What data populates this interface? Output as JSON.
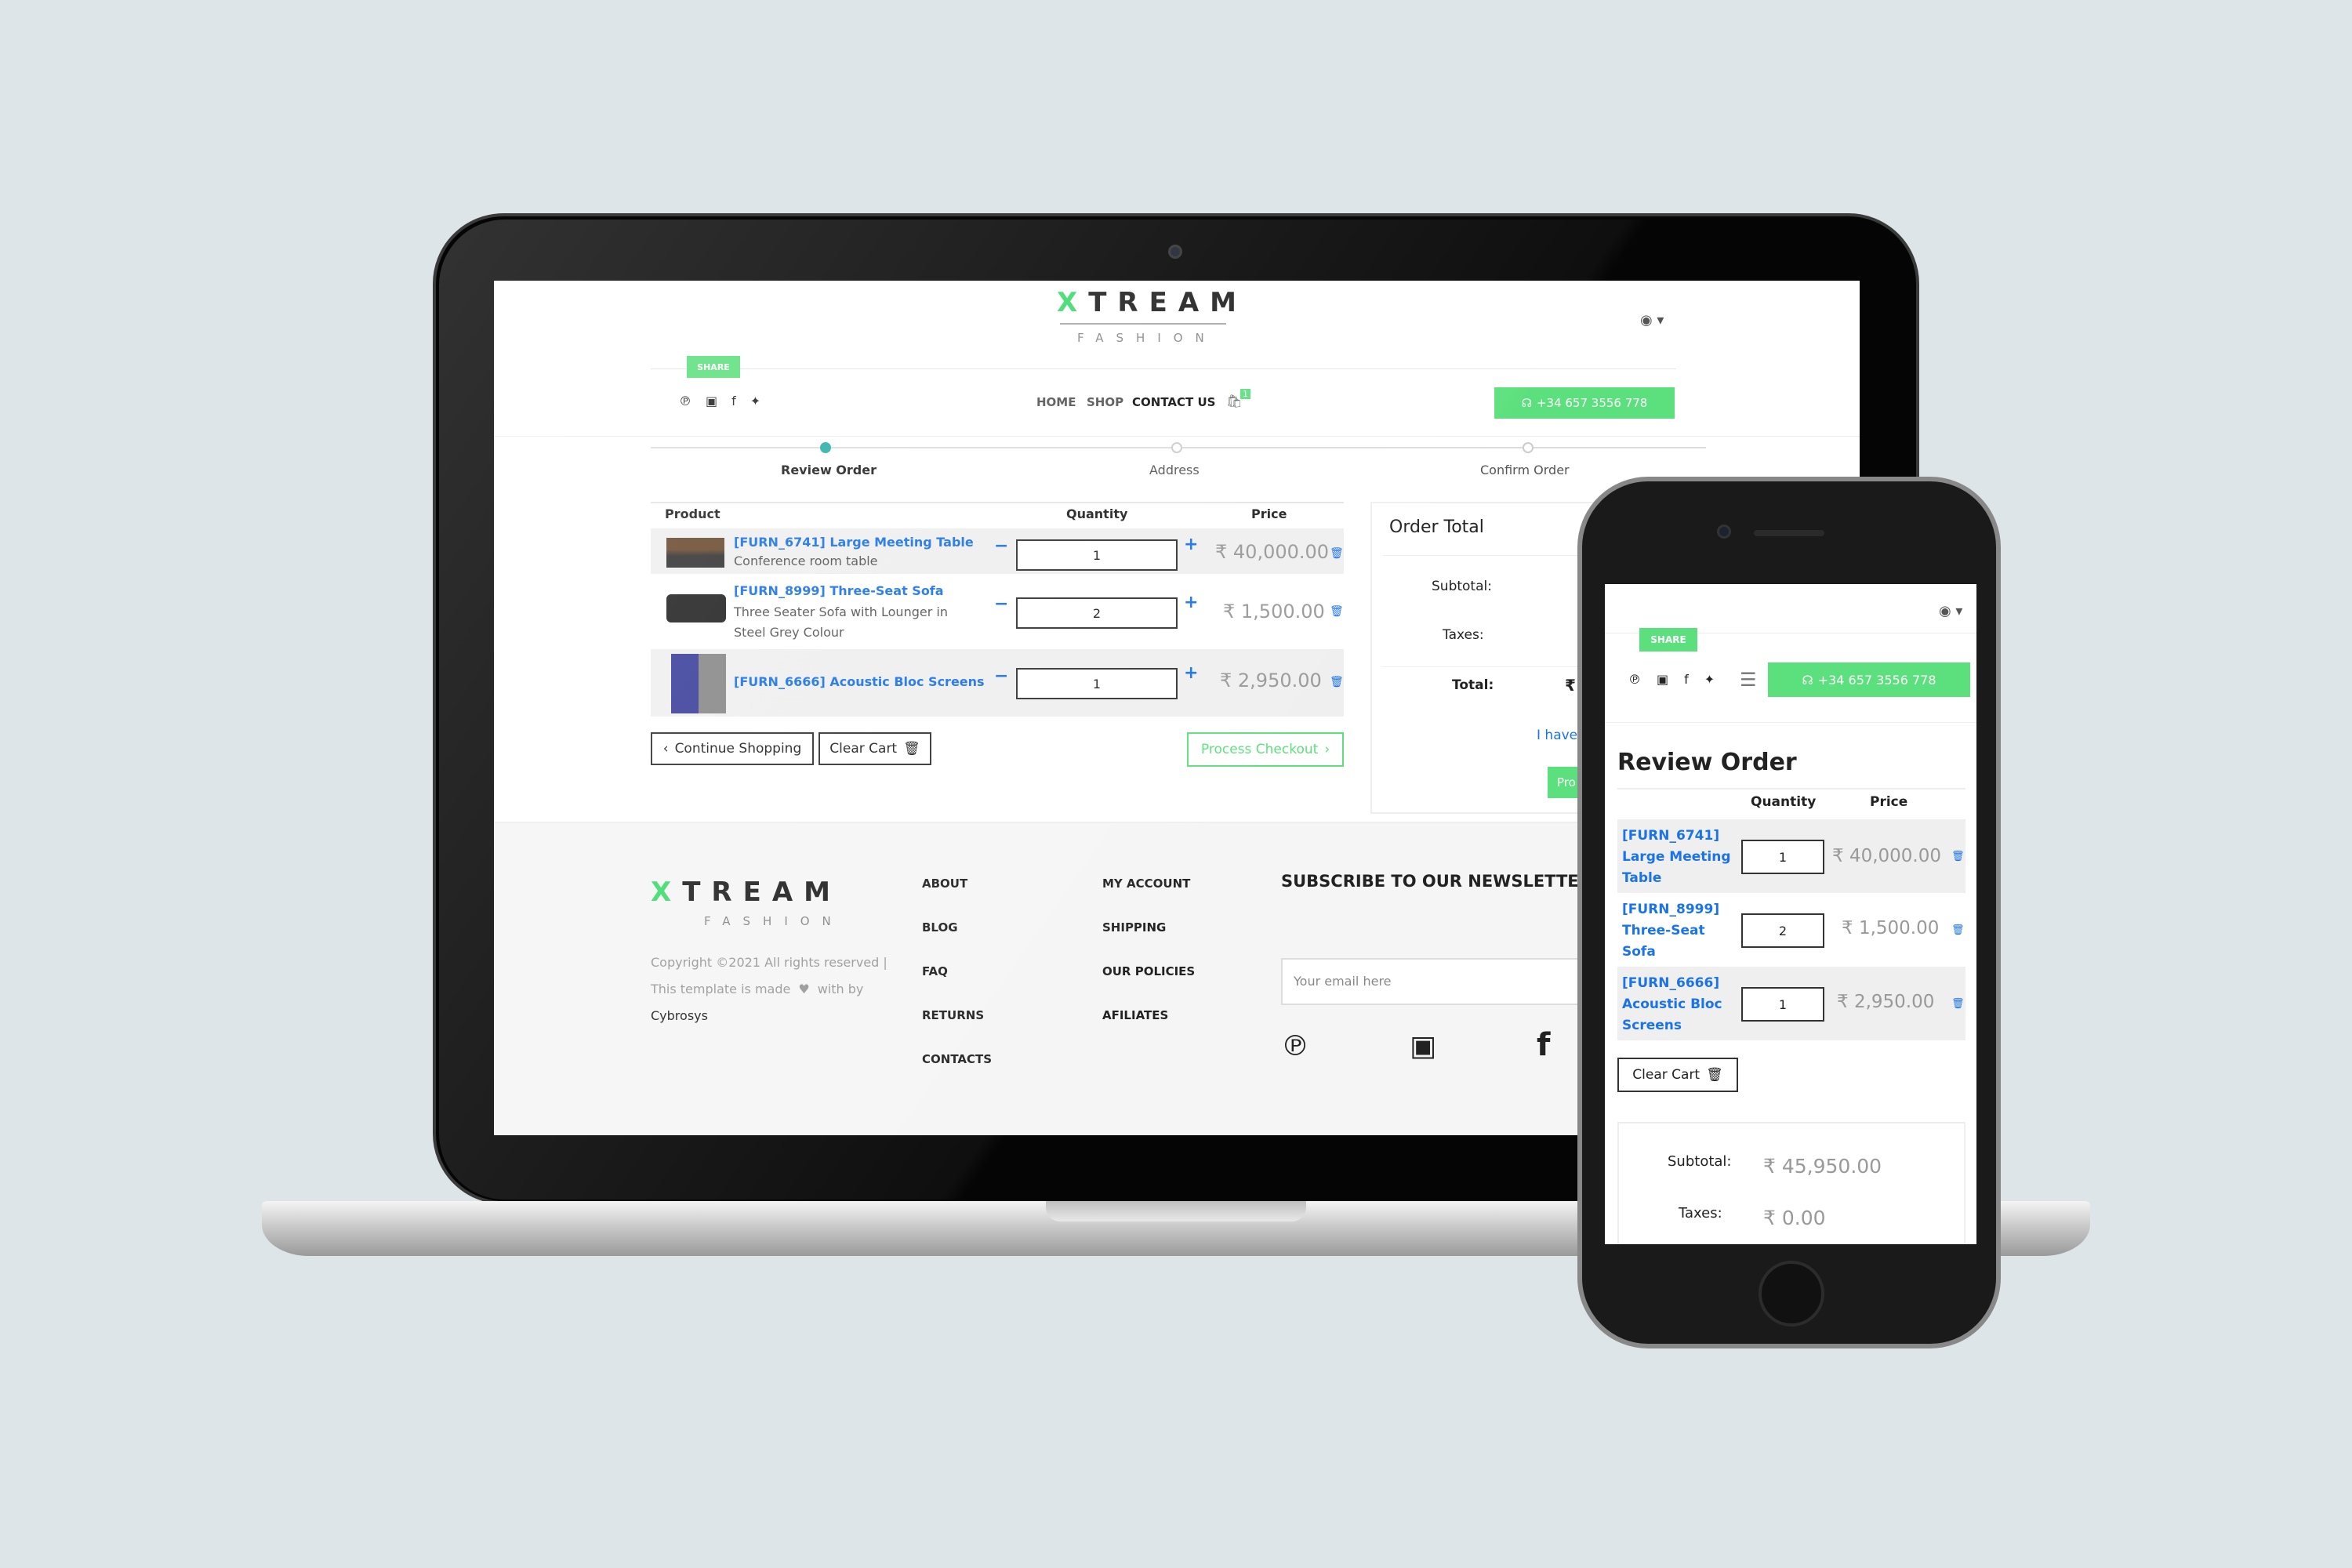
{
  "brand": {
    "logo_x": "X",
    "logo_rest": "TREAM",
    "logo_sub": "FASHION"
  },
  "header": {
    "share_label": "SHARE",
    "nav": [
      "HOME",
      "SHOP",
      "CONTACT US"
    ],
    "cart_count": "1",
    "phone": "+34 657 3556 778"
  },
  "steps": [
    "Review Order",
    "Address",
    "Confirm Order"
  ],
  "cart": {
    "headers": {
      "product": "Product",
      "quantity": "Quantity",
      "price": "Price"
    },
    "items": [
      {
        "name": "[FURN_6741] Large Meeting Table",
        "desc": "Conference room table",
        "qty": "1",
        "price": "₹ 40,000.00",
        "m_name": "[FURN_6741] Large Meeting Table"
      },
      {
        "name": "[FURN_8999] Three-Seat Sofa",
        "desc": "Three Seater Sofa with Lounger in Steel Grey Colour",
        "qty": "2",
        "price": "₹ 1,500.00",
        "m_name": "[FURN_8999] Three-Seat Sofa"
      },
      {
        "name": "[FURN_6666] Acoustic Bloc Screens",
        "desc": "",
        "qty": "1",
        "price": "₹ 2,950.00",
        "m_name": "[FURN_6666] Acoustic Bloc Screens"
      }
    ],
    "continue_label": "Continue Shopping",
    "clear_label": "Clear Cart",
    "checkout_label": "Process Checkout"
  },
  "order_total": {
    "title": "Order Total",
    "subtotal_label": "Subtotal:",
    "taxes_label": "Taxes:",
    "total_label": "Total:",
    "total_value_partial": "₹",
    "promo_partial": "I have",
    "proceed_partial": "Pro"
  },
  "footer": {
    "copyright_1": "Copyright ©2021 All rights reserved |",
    "copyright_2a": "This template is made",
    "copyright_2b": "with by",
    "company": "Cybrosys",
    "col1": [
      "ABOUT",
      "BLOG",
      "FAQ",
      "RETURNS",
      "CONTACTS"
    ],
    "col2": [
      "MY ACCOUNT",
      "SHIPPING",
      "OUR POLICIES",
      "AFILIATES"
    ],
    "newsletter_title": "SUBSCRIBE TO OUR NEWSLETTER",
    "email_placeholder": "Your email here"
  },
  "mobile": {
    "title": "Review Order",
    "subtotal_value": "₹ 45,950.00",
    "taxes_value": "₹ 0.00"
  },
  "colors": {
    "accent": "#5ce07d",
    "link": "#1a73e8",
    "bg": "#dde5e8"
  }
}
